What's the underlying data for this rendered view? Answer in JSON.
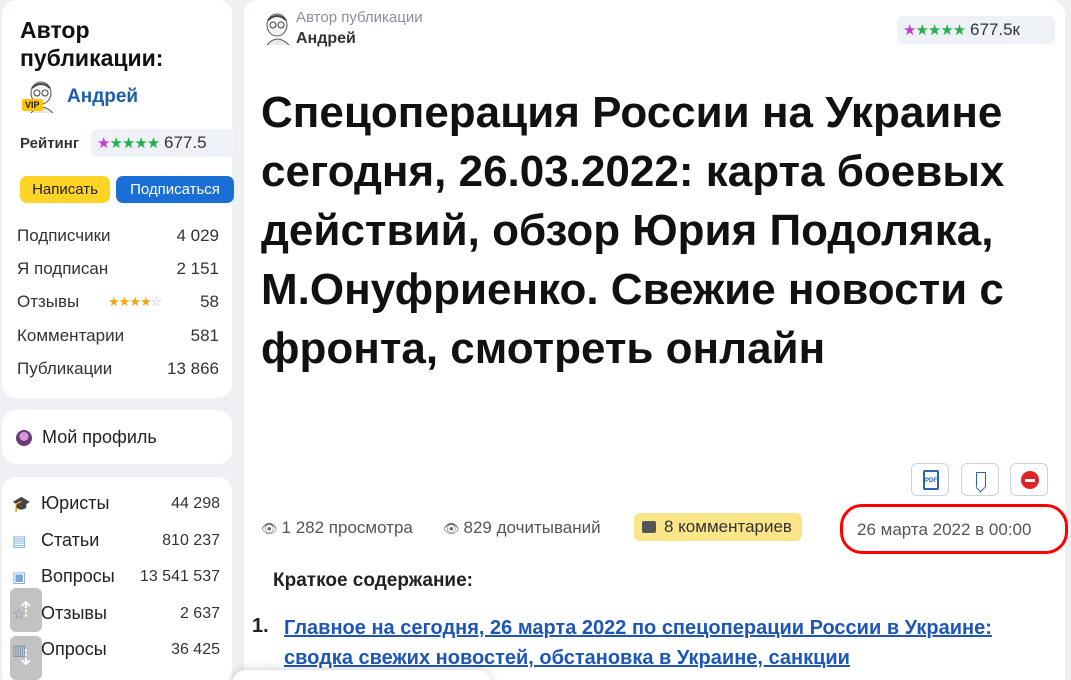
{
  "author_card": {
    "title": "Автор публикации:",
    "name": "Андрей",
    "vip_badge": "VIP",
    "rating_label": "Рейтинг",
    "rating_value": "677.5",
    "stars": "★★★★★",
    "write_button": "Написать",
    "subscribe_button": "Подписаться",
    "stats": [
      {
        "label": "Подписчики",
        "value": "4 029"
      },
      {
        "label": "Я подписан",
        "value": "2 151"
      },
      {
        "label": "Отзывы",
        "value": "58",
        "stars_filled": 4,
        "stars_total": 5
      },
      {
        "label": "Комментарии",
        "value": "581"
      },
      {
        "label": "Публикации",
        "value": "13 866"
      }
    ]
  },
  "profile": {
    "label": "Мой профиль",
    "icon": "avatar-icon"
  },
  "nav": [
    {
      "label": "Юристы",
      "value": "44 298",
      "icon": "lawyer-icon"
    },
    {
      "label": "Статьи",
      "value": "810 237",
      "icon": "articles-icon"
    },
    {
      "label": "Вопросы",
      "value": "13 541 537",
      "icon": "questions-icon"
    },
    {
      "label": "Отзывы",
      "value": "2 637",
      "icon": "reviews-icon"
    },
    {
      "label": "Опросы",
      "value": "36 425",
      "icon": "polls-icon"
    }
  ],
  "article": {
    "author_label": "Автор публикации",
    "author_name": "Андрей",
    "rating": "677.5к",
    "title": "Спецоперация России на Украине сегодня, 26.03.2022: карта боевых действий, обзор Юрия Подоляка, М.Онуфриенко. Свежие новости с фронта, смотреть онлайн",
    "views": "1 282 просмотра",
    "reads": "829 дочитываний",
    "comments": "8 комментариев",
    "date": "26 марта 2022 в 00:00",
    "pdf_label": "PDF",
    "summary_heading": "Краткое содержание:",
    "toc_number": "1.",
    "toc_item": "Главное на сегодня, 26 марта 2022 по спецоперации России в Украине: сводка свежих новостей, обстановка в Украине, санкции"
  },
  "colors": {
    "accent_blue": "#1a6fd6",
    "link": "#1e56b8",
    "yellow": "#ffd426",
    "highlight": "#ff0000"
  }
}
